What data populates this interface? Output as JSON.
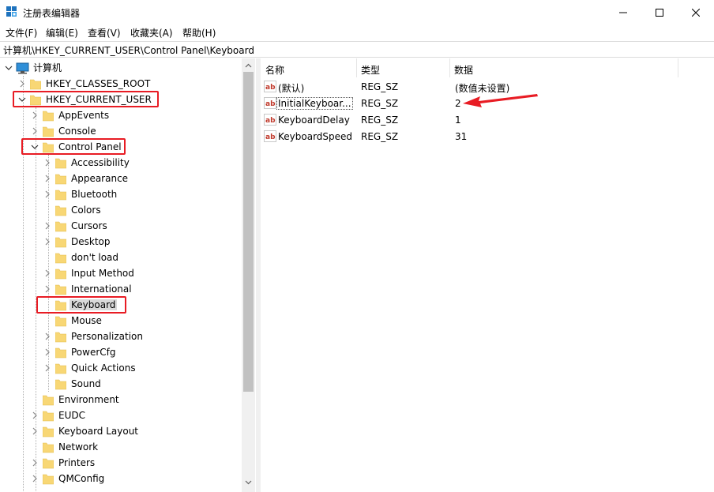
{
  "window": {
    "title": "注册表编辑器",
    "controls": {
      "minimize": "minimize",
      "maximize": "maximize",
      "close": "close"
    }
  },
  "menu": [
    "文件(F)",
    "编辑(E)",
    "查看(V)",
    "收藏夹(A)",
    "帮助(H)"
  ],
  "address": "计算机\\HKEY_CURRENT_USER\\Control Panel\\Keyboard",
  "tree": {
    "root": "计算机",
    "hkcr": "HKEY_CLASSES_ROOT",
    "hkcu": "HKEY_CURRENT_USER",
    "hkcu_children": [
      "AppEvents",
      "Console",
      "Control Panel"
    ],
    "control_panel_children": [
      "Accessibility",
      "Appearance",
      "Bluetooth",
      "Colors",
      "Cursors",
      "Desktop",
      "don't load",
      "Input Method",
      "International",
      "Keyboard",
      "Mouse",
      "Personalization",
      "PowerCfg",
      "Quick Actions",
      "Sound"
    ],
    "hkcu_more": [
      "Environment",
      "EUDC",
      "Keyboard Layout",
      "Network",
      "Printers",
      "QMConfig"
    ],
    "selected": "Keyboard"
  },
  "list": {
    "headers": {
      "name": "名称",
      "type": "类型",
      "data": "数据"
    },
    "rows": [
      {
        "name": "(默认)",
        "type": "REG_SZ",
        "data": "(数值未设置)"
      },
      {
        "name": "InitialKeyboar...",
        "type": "REG_SZ",
        "data": "2"
      },
      {
        "name": "KeyboardDelay",
        "type": "REG_SZ",
        "data": "1"
      },
      {
        "name": "KeyboardSpeed",
        "type": "REG_SZ",
        "data": "31"
      }
    ]
  },
  "colors": {
    "highlight": "#e81c24",
    "folder": "#f8d775",
    "selection": "#d9d9d9"
  }
}
